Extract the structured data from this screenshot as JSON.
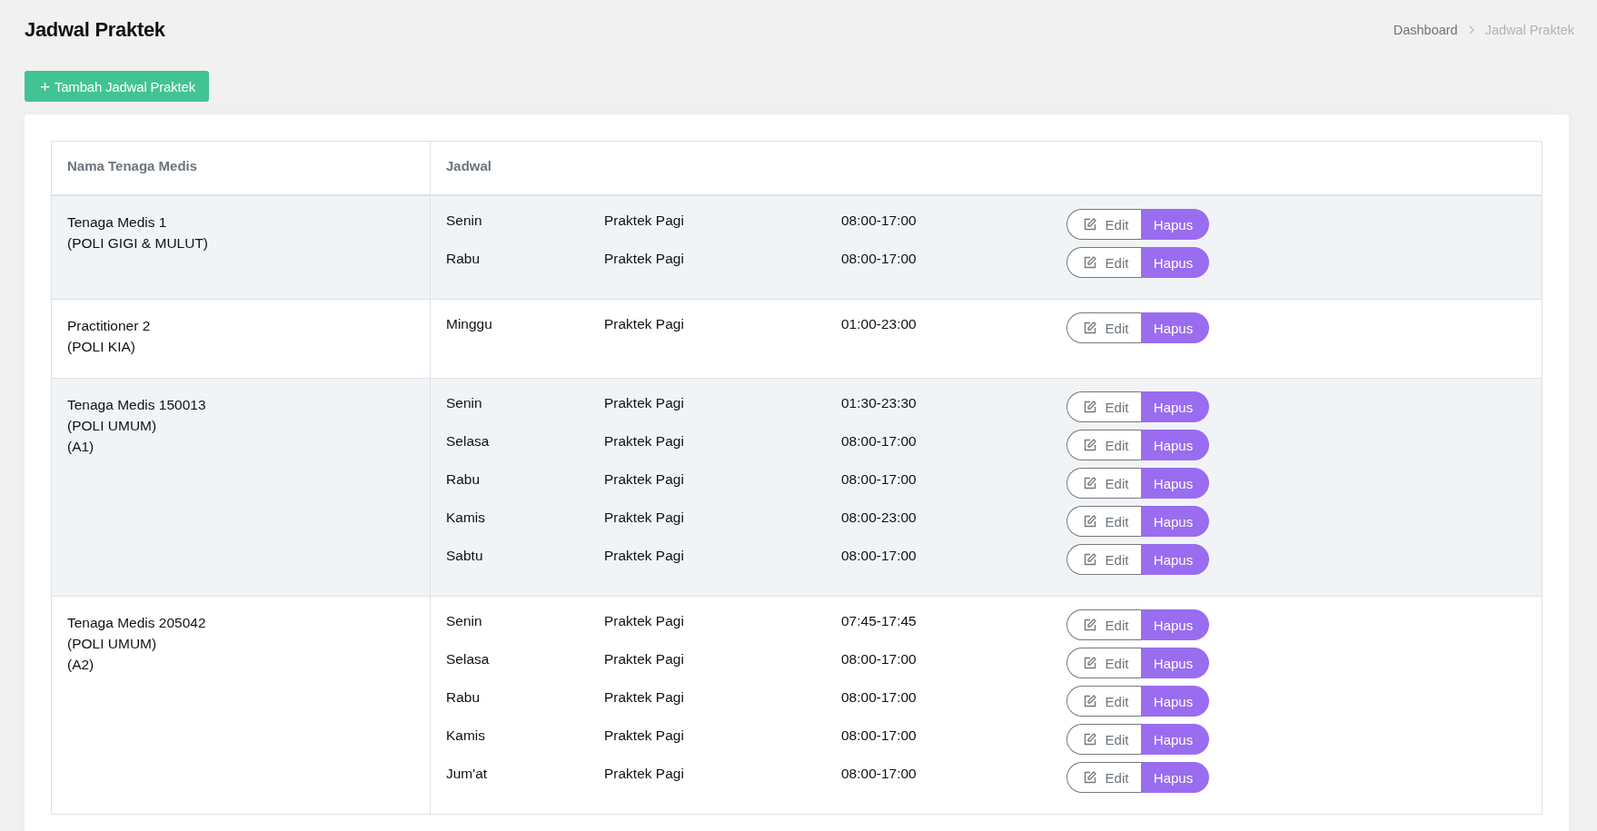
{
  "page": {
    "title": "Jadwal Praktek"
  },
  "breadcrumb": [
    {
      "label": "Dashboard",
      "current": false
    },
    {
      "label": "Jadwal Praktek",
      "current": true
    }
  ],
  "add_button": {
    "icon": "+",
    "label": "Tambah Jadwal Praktek"
  },
  "table": {
    "columns": [
      "Nama Tenaga Medis",
      "Jadwal"
    ],
    "rows": [
      {
        "name_lines": [
          "Tenaga Medis 1",
          "(POLI GIGI & MULUT)"
        ],
        "schedules": [
          {
            "day": "Senin",
            "session": "Praktek Pagi",
            "time": "08:00-17:00",
            "edit": "Edit",
            "delete": "Hapus"
          },
          {
            "day": "Rabu",
            "session": "Praktek Pagi",
            "time": "08:00-17:00",
            "edit": "Edit",
            "delete": "Hapus"
          }
        ]
      },
      {
        "name_lines": [
          "Practitioner 2",
          "(POLI KIA)"
        ],
        "schedules": [
          {
            "day": "Minggu",
            "session": "Praktek Pagi",
            "time": "01:00-23:00",
            "edit": "Edit",
            "delete": "Hapus"
          }
        ]
      },
      {
        "name_lines": [
          "Tenaga Medis 150013",
          "(POLI UMUM)",
          "(A1)"
        ],
        "schedules": [
          {
            "day": "Senin",
            "session": "Praktek Pagi",
            "time": "01:30-23:30",
            "edit": "Edit",
            "delete": "Hapus"
          },
          {
            "day": "Selasa",
            "session": "Praktek Pagi",
            "time": "08:00-17:00",
            "edit": "Edit",
            "delete": "Hapus"
          },
          {
            "day": "Rabu",
            "session": "Praktek Pagi",
            "time": "08:00-17:00",
            "edit": "Edit",
            "delete": "Hapus"
          },
          {
            "day": "Kamis",
            "session": "Praktek Pagi",
            "time": "08:00-23:00",
            "edit": "Edit",
            "delete": "Hapus"
          },
          {
            "day": "Sabtu",
            "session": "Praktek Pagi",
            "time": "08:00-17:00",
            "edit": "Edit",
            "delete": "Hapus"
          }
        ]
      },
      {
        "name_lines": [
          "Tenaga Medis 205042",
          "(POLI UMUM)",
          "(A2)"
        ],
        "schedules": [
          {
            "day": "Senin",
            "session": "Praktek Pagi",
            "time": "07:45-17:45",
            "edit": "Edit",
            "delete": "Hapus"
          },
          {
            "day": "Selasa",
            "session": "Praktek Pagi",
            "time": "08:00-17:00",
            "edit": "Edit",
            "delete": "Hapus"
          },
          {
            "day": "Rabu",
            "session": "Praktek Pagi",
            "time": "08:00-17:00",
            "edit": "Edit",
            "delete": "Hapus"
          },
          {
            "day": "Kamis",
            "session": "Praktek Pagi",
            "time": "08:00-17:00",
            "edit": "Edit",
            "delete": "Hapus"
          },
          {
            "day": "Jum'at",
            "session": "Praktek Pagi",
            "time": "08:00-17:00",
            "edit": "Edit",
            "delete": "Hapus"
          }
        ]
      }
    ]
  }
}
